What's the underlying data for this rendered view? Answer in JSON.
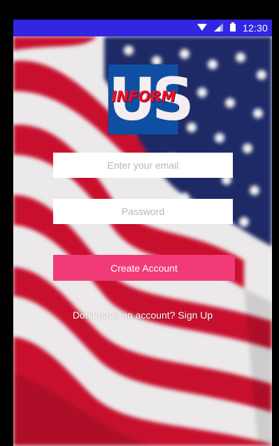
{
  "status_bar": {
    "time": "12:30",
    "icons": [
      "wifi-icon",
      "signal-icon",
      "battery-icon"
    ],
    "background": "#3326e0"
  },
  "logo": {
    "letters": "US",
    "word": "INFORM",
    "colors": {
      "tile": "#0f4fa3",
      "letters": "#f4eef0",
      "word": "#e8122c"
    }
  },
  "form": {
    "email_placeholder": "Enter your email",
    "password_placeholder": "Password",
    "create_account_label": "Create Account",
    "button_color": "#f13b76"
  },
  "footer": {
    "prompt": "Don't have an account? ",
    "signup_label": "Sign Up"
  },
  "background": {
    "image": "us-flag-background",
    "stripe_red": "#c8102e",
    "stripe_white": "#f2f2f2",
    "union_blue": "#1e2a66"
  }
}
